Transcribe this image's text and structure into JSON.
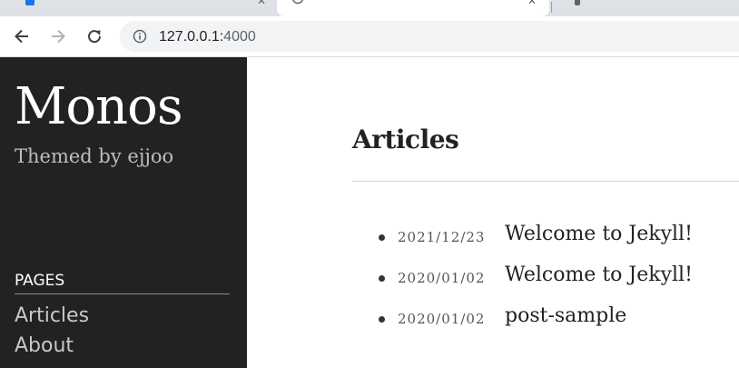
{
  "browser": {
    "url_host": "127.0.0.1:",
    "url_port": "4000"
  },
  "sidebar": {
    "title": "Monos",
    "subtitle": "Themed by ejjoo",
    "pages_heading": "PAGES",
    "nav": [
      {
        "label": "Articles"
      },
      {
        "label": "About"
      }
    ]
  },
  "main": {
    "heading": "Articles",
    "posts": [
      {
        "date": "2021/12/23",
        "title": "Welcome to Jekyll!"
      },
      {
        "date": "2020/01/02",
        "title": "Welcome to Jekyll!"
      },
      {
        "date": "2020/01/02",
        "title": "post-sample"
      }
    ]
  },
  "colors": {
    "sidebar_bg": "#222222",
    "tabstrip_bg": "#dee1e6",
    "omnibox_bg": "#f1f3f4"
  }
}
